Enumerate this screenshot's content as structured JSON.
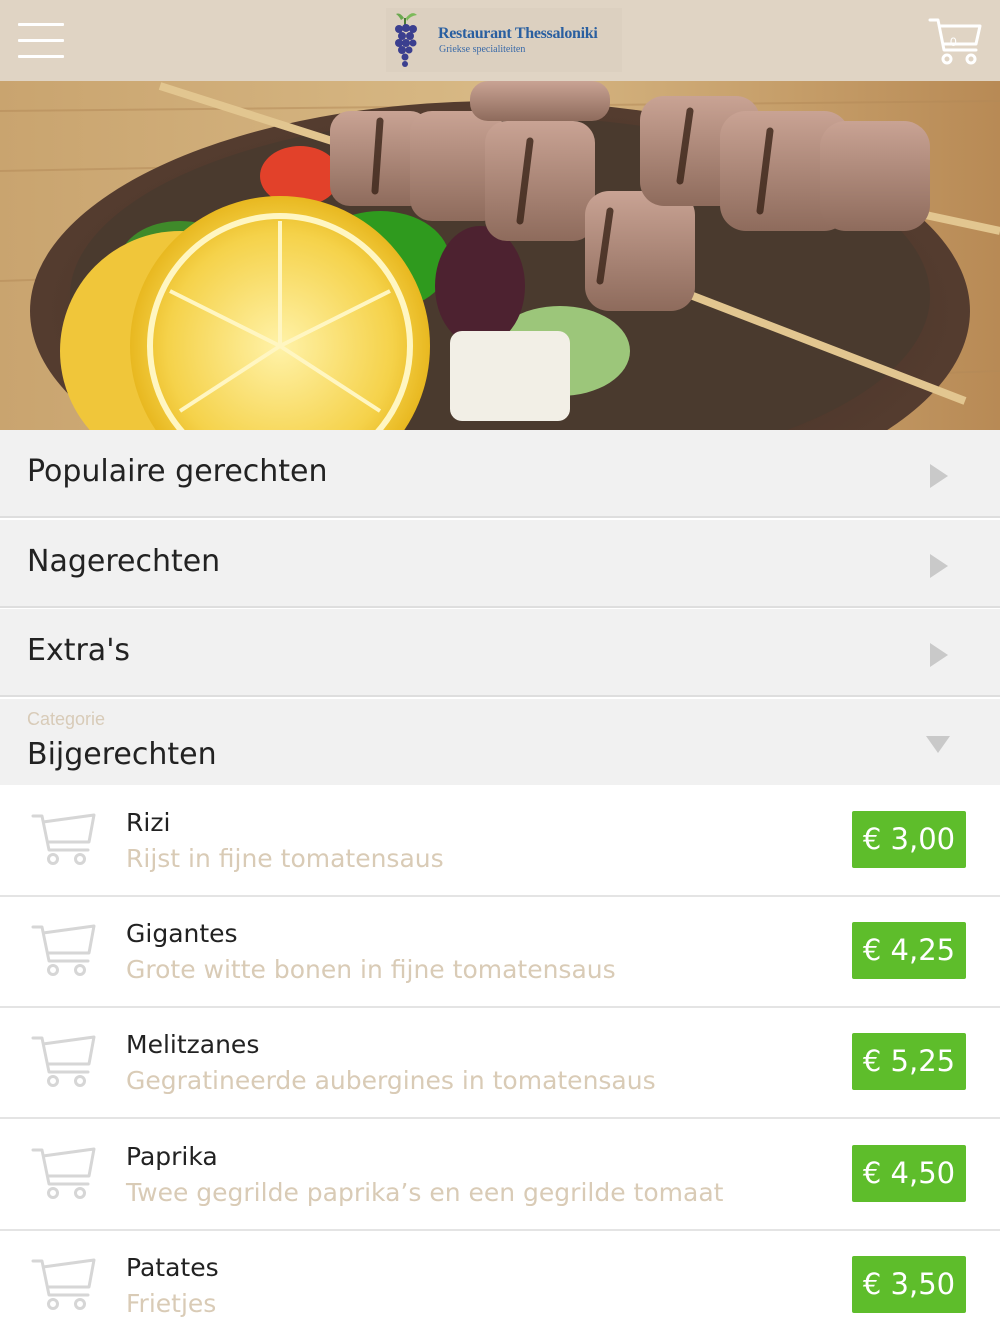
{
  "header": {
    "logo_title": "Restaurant Thessaloniki",
    "logo_subtitle": "Griekse specialiteiten",
    "cart_count": "0"
  },
  "menu": {
    "categories": [
      {
        "label": "Populaire gerechten"
      },
      {
        "label": "Nagerechten"
      },
      {
        "label": "Extra's"
      }
    ],
    "category_select": {
      "caption": "Categorie",
      "value": "Bijgerechten"
    }
  },
  "products": [
    {
      "name": "Rizi",
      "description": "Rijst in fijne tomatensaus",
      "price": "€ 3,00"
    },
    {
      "name": "Gigantes",
      "description": "Grote witte bonen in fijne tomatensaus",
      "price": "€ 4,25"
    },
    {
      "name": "Melitzanes",
      "description": "Gegratineerde aubergines in tomatensaus",
      "price": "€ 5,25"
    },
    {
      "name": "Paprika",
      "description": "Twee gegrilde paprika’s en een gegrilde tomaat",
      "price": "€ 4,50"
    },
    {
      "name": "Patates",
      "description": "Frietjes",
      "price": "€ 3,50"
    }
  ],
  "colors": {
    "header_bg": "#e0d4c4",
    "price_green": "#5ebd2b",
    "description_beige": "#d9cbb6",
    "category_bg": "#f1f1f1"
  },
  "icons": {
    "menu": "hamburger-menu-icon",
    "cart": "shopping-cart-icon",
    "row_arrow": "triangle-right-icon",
    "select_arrow": "triangle-down-icon",
    "logo": "grapes-logo-icon"
  }
}
